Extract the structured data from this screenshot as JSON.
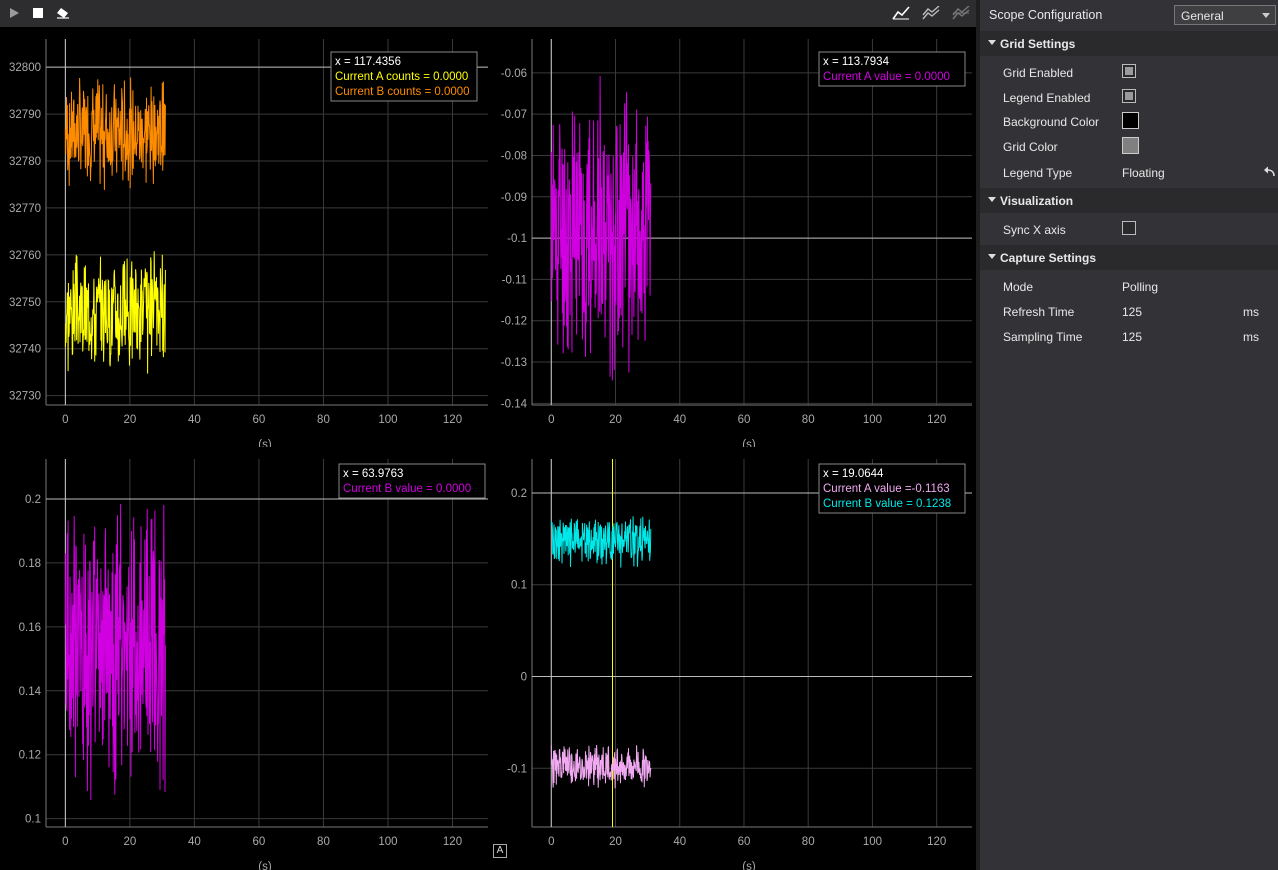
{
  "toolbar": {
    "left_icons": [
      "play-icon",
      "stop-icon",
      "eraser-icon"
    ],
    "right_icons": [
      "line-chart-icon",
      "line-chart-alt-icon",
      "line-chart-disabled-icon"
    ]
  },
  "colors": {
    "orange": "#ff8c00",
    "yellow": "#ffff00",
    "magenta": "#d000e0",
    "cyan": "#00e8e8",
    "pink": "#f0a8f0",
    "grid": "#3a3a3a",
    "axis_text": "#aaaaaa"
  },
  "charts": [
    {
      "legend": [
        {
          "text": "x = 117.4356",
          "color": "#ffffff"
        },
        {
          "text": "Current A counts = 0.0000",
          "color": "#ffff00"
        },
        {
          "text": "Current B counts = 0.0000",
          "color": "#ff8c00"
        }
      ],
      "x_label": "(s)",
      "x_ticks": [
        "0",
        "20",
        "40",
        "60",
        "80",
        "100",
        "120"
      ],
      "y_ticks": [
        "32730",
        "32740",
        "32750",
        "32760",
        "32770",
        "32780",
        "32790",
        "32800"
      ]
    },
    {
      "legend": [
        {
          "text": "x = 113.7934",
          "color": "#ffffff"
        },
        {
          "text": "Current A value = 0.0000",
          "color": "#d000e0"
        }
      ],
      "x_label": "(s)",
      "x_ticks": [
        "0",
        "20",
        "40",
        "60",
        "80",
        "100",
        "120"
      ],
      "y_ticks": [
        "-0.14",
        "-0.13",
        "-0.12",
        "-0.11",
        "-0.1",
        "-0.09",
        "-0.08",
        "-0.07",
        "-0.06"
      ]
    },
    {
      "legend": [
        {
          "text": "x = 63.9763",
          "color": "#ffffff"
        },
        {
          "text": "Current B value = 0.0000",
          "color": "#d000e0"
        }
      ],
      "x_label": "(s)",
      "x_ticks": [
        "0",
        "20",
        "40",
        "60",
        "80",
        "100",
        "120"
      ],
      "y_ticks": [
        "0.1",
        "0.12",
        "0.14",
        "0.16",
        "0.18",
        "0.2"
      ]
    },
    {
      "legend": [
        {
          "text": "x = 19.0644",
          "color": "#ffffff"
        },
        {
          "text": "Current A value =-0.1163",
          "color": "#f0a8f0"
        },
        {
          "text": "Current B value = 0.1238",
          "color": "#00e8e8"
        }
      ],
      "x_label": "(s)",
      "x_ticks": [
        "0",
        "20",
        "40",
        "60",
        "80",
        "100",
        "120"
      ],
      "y_ticks": [
        "-0.1",
        "0",
        "0.1",
        "0.2"
      ]
    }
  ],
  "chart_data": [
    {
      "type": "line",
      "xlim": [
        -6,
        131
      ],
      "ylim": [
        32728,
        32806
      ],
      "series": [
        {
          "name": "Current A counts",
          "color": "#ffff00",
          "x_range": [
            0,
            31
          ],
          "center": 32748,
          "noise": 14,
          "seed": 3
        },
        {
          "name": "Current B counts",
          "color": "#ff8c00",
          "x_range": [
            0,
            31
          ],
          "center": 32786,
          "noise": 13,
          "seed": 7
        }
      ],
      "cursor_y": 32800
    },
    {
      "type": "line",
      "xlim": [
        -6,
        131
      ],
      "ylim": [
        -0.1404,
        -0.0518
      ],
      "series": [
        {
          "name": "Current A value",
          "color": "#d000e0",
          "x_range": [
            0,
            31
          ],
          "center": -0.098,
          "noise": 0.038,
          "seed": 11
        }
      ],
      "cursor_y": -0.1
    },
    {
      "type": "line",
      "xlim": [
        -6,
        131
      ],
      "ylim": [
        0.0974,
        0.2125
      ],
      "series": [
        {
          "name": "Current B value",
          "color": "#d000e0",
          "x_range": [
            0,
            31
          ],
          "center": 0.153,
          "noise": 0.052,
          "seed": 19
        }
      ],
      "cursor_y": 0.2
    },
    {
      "type": "line",
      "xlim": [
        -6,
        131
      ],
      "ylim": [
        -0.164,
        0.237
      ],
      "series": [
        {
          "name": "Current A value",
          "color": "#f0a8f0",
          "x_range": [
            0,
            31
          ],
          "center": -0.097,
          "noise": 0.028,
          "seed": 23
        },
        {
          "name": "Current B value",
          "color": "#00e8e8",
          "x_range": [
            0,
            31
          ],
          "center": 0.148,
          "noise": 0.03,
          "seed": 29
        }
      ],
      "cursor_y": 0.2,
      "cursor_x": 19.0644
    }
  ],
  "auto_button": "A",
  "panel": {
    "title": "Scope Configuration",
    "dropdown_value": "General",
    "grid_settings": {
      "title": "Grid Settings",
      "grid_enabled": {
        "label": "Grid Enabled",
        "checked": true
      },
      "legend_enabled": {
        "label": "Legend Enabled",
        "checked": true
      },
      "background_color": {
        "label": "Background Color",
        "color": "#000000"
      },
      "grid_color": {
        "label": "Grid Color",
        "color": "#808080"
      },
      "legend_type": {
        "label": "Legend Type",
        "value": "Floating"
      }
    },
    "visualization": {
      "title": "Visualization",
      "sync_x_axis": {
        "label": "Sync X axis",
        "checked": false
      }
    },
    "capture_settings": {
      "title": "Capture Settings",
      "mode": {
        "label": "Mode",
        "value": "Polling"
      },
      "refresh_time": {
        "label": "Refresh Time",
        "value": "125",
        "unit": "ms"
      },
      "sampling_time": {
        "label": "Sampling Time",
        "value": "125",
        "unit": "ms"
      }
    }
  }
}
